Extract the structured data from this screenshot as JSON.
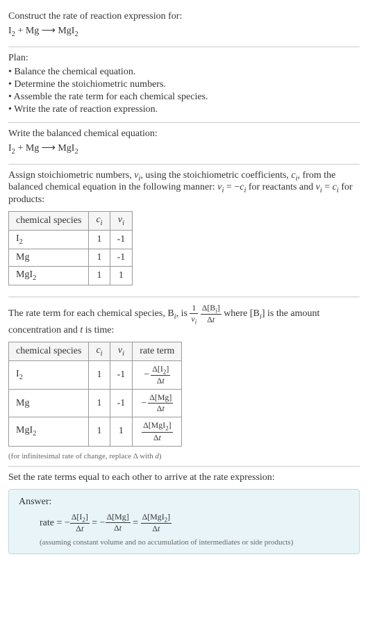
{
  "intro": {
    "title": "Construct the rate of reaction expression for:",
    "equation_html": "I<sub>2</sub> + Mg ⟶ MgI<sub>2</sub>"
  },
  "plan": {
    "label": "Plan:",
    "items": [
      "• Balance the chemical equation.",
      "• Determine the stoichiometric numbers.",
      "• Assemble the rate term for each chemical species.",
      "• Write the rate of reaction expression."
    ]
  },
  "balanced": {
    "title": "Write the balanced chemical equation:",
    "equation_html": "I<sub>2</sub> + Mg ⟶ MgI<sub>2</sub>"
  },
  "stoich": {
    "text_html": "Assign stoichiometric numbers, <span class='italic'>ν<sub>i</sub></span>, using the stoichiometric coefficients, <span class='italic'>c<sub>i</sub></span>, from the balanced chemical equation in the following manner: <span class='italic'>ν<sub>i</sub></span> = −<span class='italic'>c<sub>i</sub></span> for reactants and <span class='italic'>ν<sub>i</sub></span> = <span class='italic'>c<sub>i</sub></span> for products:",
    "headers": {
      "species": "chemical species",
      "ci_html": "<span class='italic'>c<sub>i</sub></span>",
      "vi_html": "<span class='italic'>ν<sub>i</sub></span>"
    },
    "rows": [
      {
        "species_html": "I<sub>2</sub>",
        "ci": "1",
        "vi": "-1"
      },
      {
        "species_html": "Mg",
        "ci": "1",
        "vi": "-1"
      },
      {
        "species_html": "MgI<sub>2</sub>",
        "ci": "1",
        "vi": "1"
      }
    ]
  },
  "rateterm": {
    "text_before_html": "The rate term for each chemical species, B<sub><span class='italic'>i</span></sub>, is ",
    "formula_html": "<span class='frac'><span class='num'>1</span><span class='den'><span class='italic'>ν<sub>i</sub></span></span></span> <span class='frac'><span class='num'>Δ[B<sub><span class='italic'>i</span></sub>]</span><span class='den'>Δ<span class='italic'>t</span></span></span>",
    "text_after_html": " where [B<sub><span class='italic'>i</span></sub>] is the amount concentration and <span class='italic'>t</span> is time:",
    "headers": {
      "species": "chemical species",
      "ci_html": "<span class='italic'>c<sub>i</sub></span>",
      "vi_html": "<span class='italic'>ν<sub>i</sub></span>",
      "rate": "rate term"
    },
    "rows": [
      {
        "species_html": "I<sub>2</sub>",
        "ci": "1",
        "vi": "-1",
        "rate_html": "<span class='neg'>−</span><span class='frac'><span class='num'>Δ[I<sub>2</sub>]</span><span class='den'>Δ<span class='italic'>t</span></span></span>"
      },
      {
        "species_html": "Mg",
        "ci": "1",
        "vi": "-1",
        "rate_html": "<span class='neg'>−</span><span class='frac'><span class='num'>Δ[Mg]</span><span class='den'>Δ<span class='italic'>t</span></span></span>"
      },
      {
        "species_html": "MgI<sub>2</sub>",
        "ci": "1",
        "vi": "1",
        "rate_html": "<span class='frac'><span class='num'>Δ[MgI<sub>2</sub>]</span><span class='den'>Δ<span class='italic'>t</span></span></span>"
      }
    ],
    "note_html": "(for infinitesimal rate of change, replace Δ with <span class='italic'>d</span>)"
  },
  "final": {
    "title": "Set the rate terms equal to each other to arrive at the rate expression:",
    "answer_label": "Answer:",
    "answer_html": "rate = −<span class='frac'><span class='num'>Δ[I<sub>2</sub>]</span><span class='den'>Δ<span class='italic'>t</span></span></span> = −<span class='frac'><span class='num'>Δ[Mg]</span><span class='den'>Δ<span class='italic'>t</span></span></span> = <span class='frac'><span class='num'>Δ[MgI<sub>2</sub>]</span><span class='den'>Δ<span class='italic'>t</span></span></span>",
    "answer_note": "(assuming constant volume and no accumulation of intermediates or side products)"
  }
}
